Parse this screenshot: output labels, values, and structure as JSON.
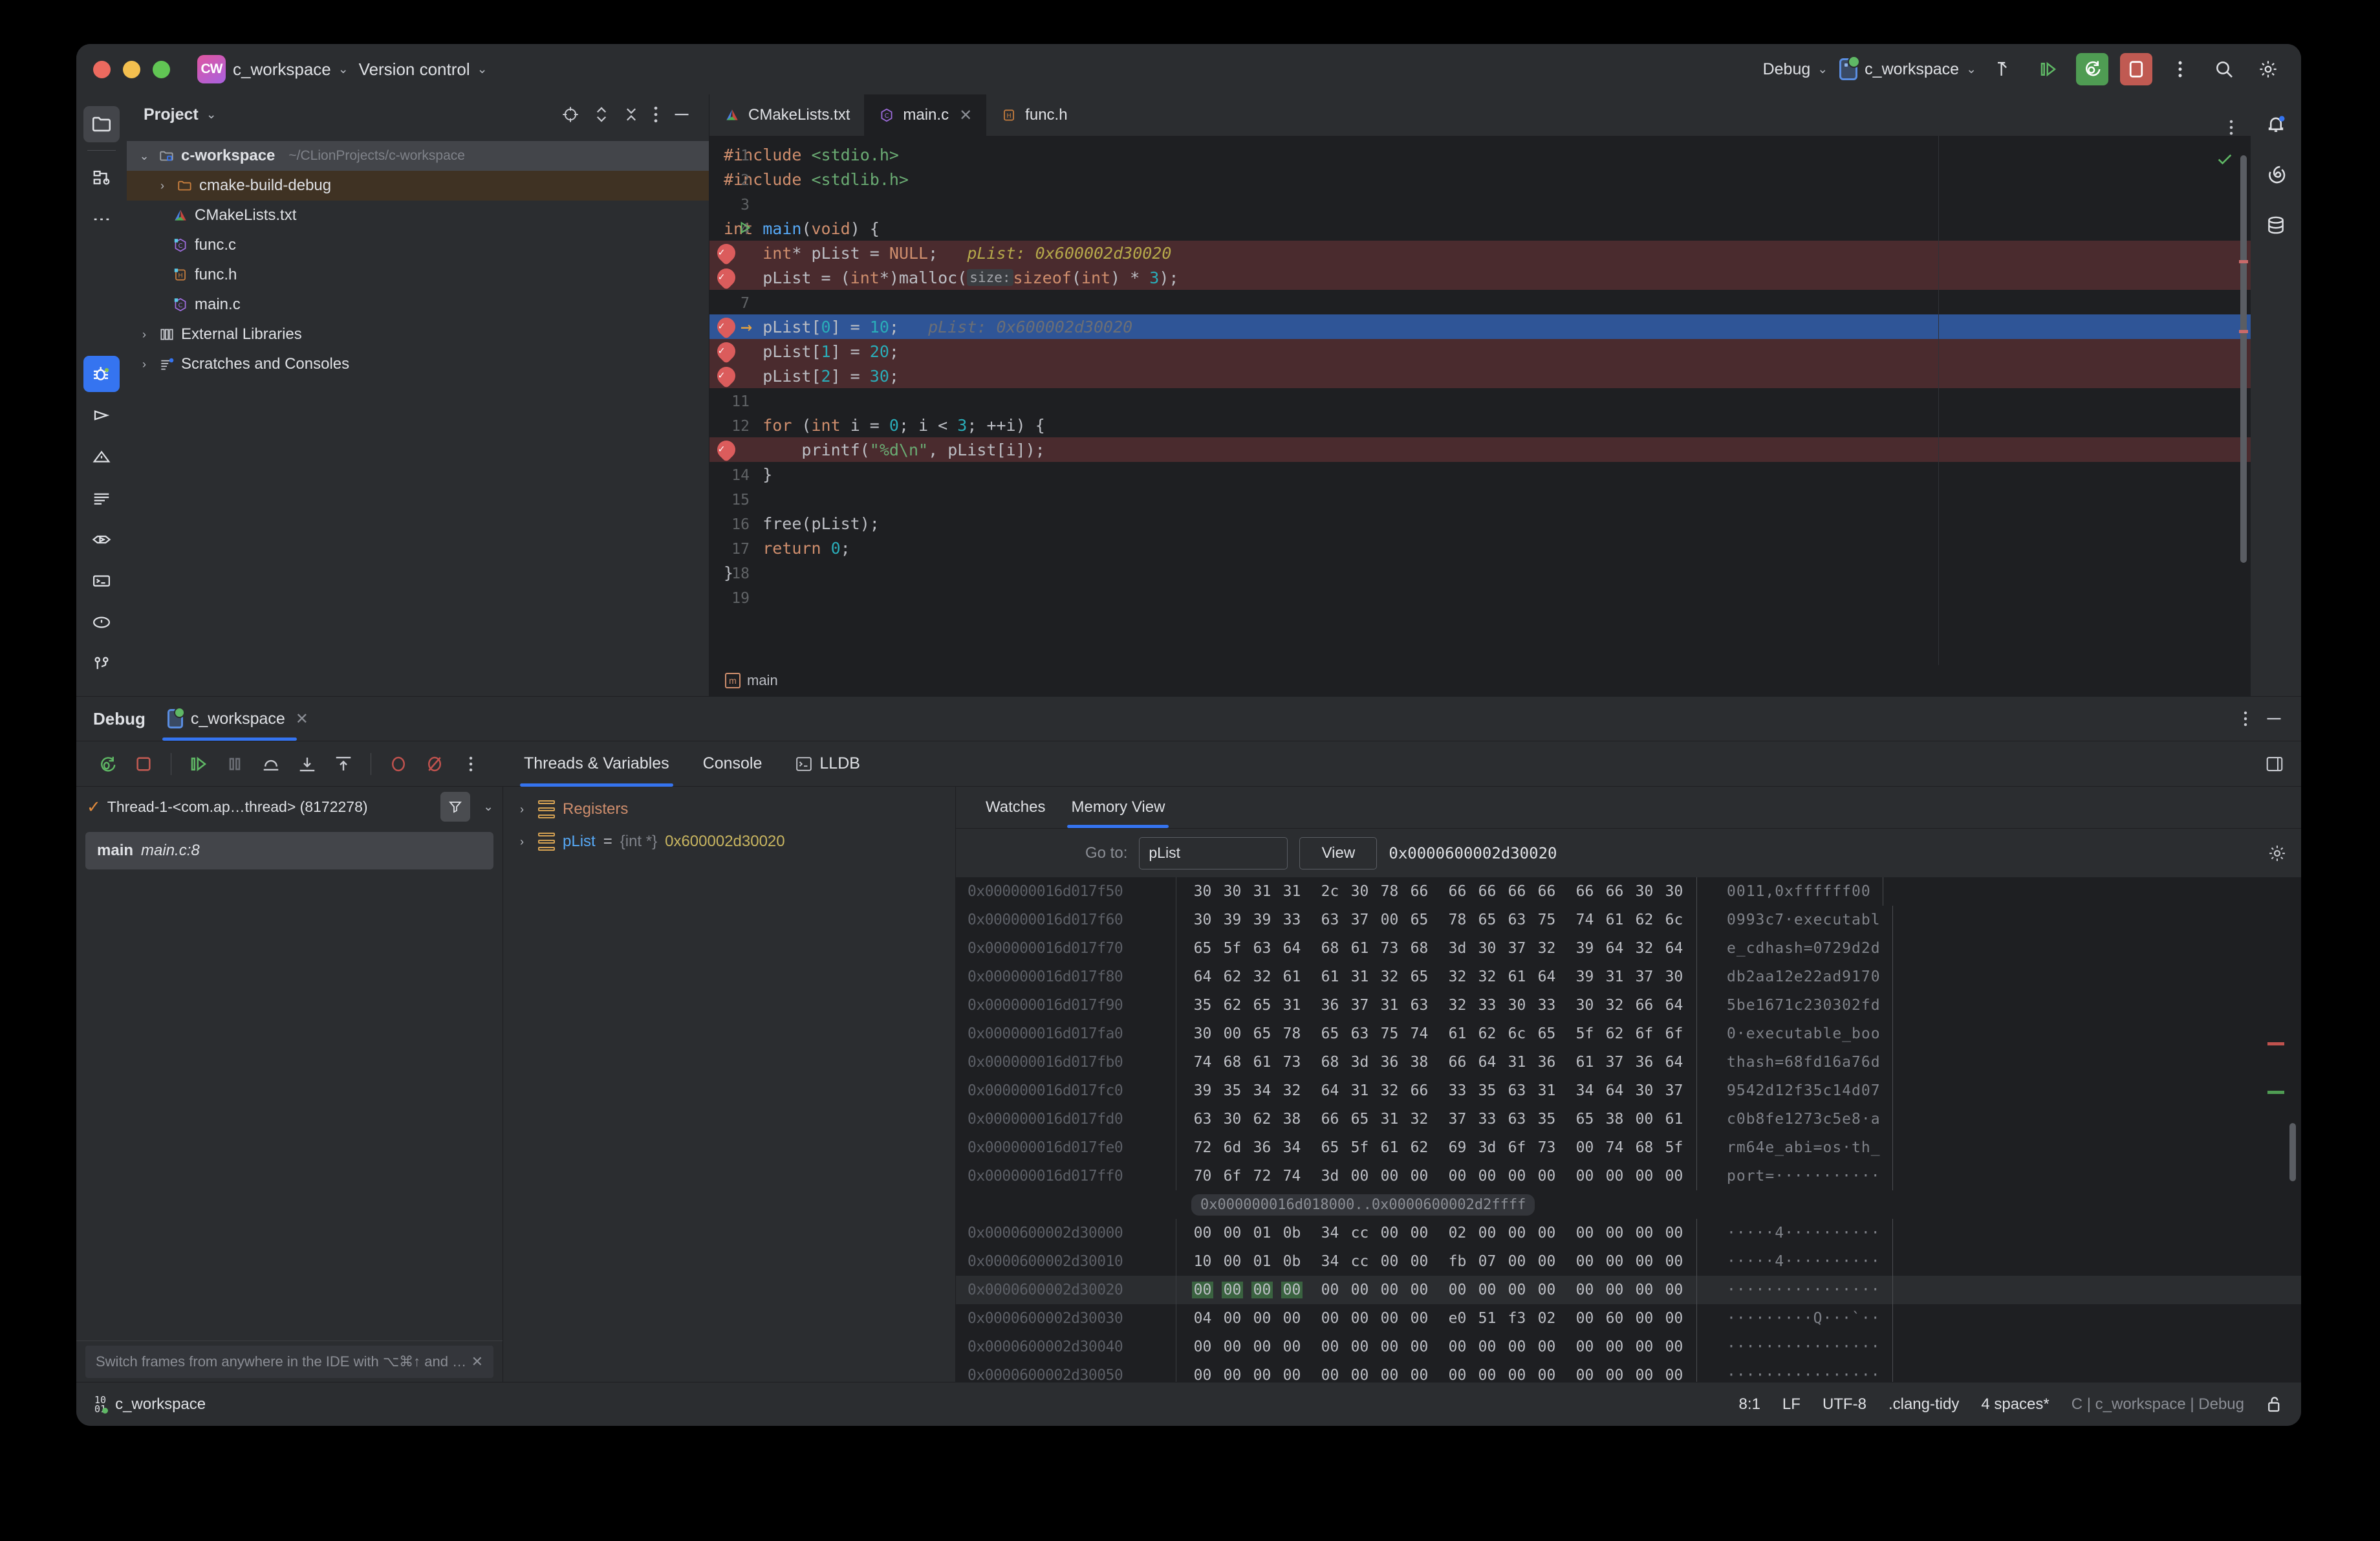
{
  "titlebar": {
    "project_badge": "CW",
    "project_name": "c_workspace",
    "version_control": "Version control",
    "run_config_mode": "Debug",
    "run_config_name": "c_workspace",
    "chevron": "⌄"
  },
  "project_panel": {
    "title": "Project",
    "chevron": "⌄",
    "tree": [
      {
        "label": "c-workspace",
        "detail": "~/CLionProjects/c-workspace",
        "icon": "folder-project-icon",
        "state": "selected",
        "depth": 0,
        "arrow": "⌄"
      },
      {
        "label": "cmake-build-debug",
        "detail": "",
        "icon": "folder-icon",
        "state": "highlighted",
        "depth": 1,
        "arrow": "›"
      },
      {
        "label": "CMakeLists.txt",
        "detail": "",
        "icon": "cmake-icon",
        "state": "",
        "depth": 1,
        "arrow": ""
      },
      {
        "label": "func.c",
        "detail": "",
        "icon": "c-file-icon",
        "state": "",
        "depth": 1,
        "arrow": ""
      },
      {
        "label": "func.h",
        "detail": "",
        "icon": "h-file-icon",
        "state": "",
        "depth": 1,
        "arrow": ""
      },
      {
        "label": "main.c",
        "detail": "",
        "icon": "c-file-icon",
        "state": "",
        "depth": 1,
        "arrow": ""
      },
      {
        "label": "External Libraries",
        "detail": "",
        "icon": "library-icon",
        "state": "",
        "depth": 0,
        "arrow": "›"
      },
      {
        "label": "Scratches and Consoles",
        "detail": "",
        "icon": "scratches-icon",
        "state": "",
        "depth": 0,
        "arrow": "›"
      }
    ]
  },
  "editor": {
    "tabs": [
      {
        "label": "CMakeLists.txt",
        "icon": "cmake-icon",
        "active": false,
        "closable": false
      },
      {
        "label": "main.c",
        "icon": "c-file-icon",
        "active": true,
        "closable": true
      },
      {
        "label": "func.h",
        "icon": "h-file-icon",
        "active": false,
        "closable": false
      }
    ],
    "close_glyph": "✕",
    "breadcrumb": "main",
    "breadcrumb_icon": "m",
    "lines": [
      {
        "num": "1",
        "breakpoint": false,
        "state": "",
        "segments": [
          {
            "t": "#include ",
            "c": "kw"
          },
          {
            "t": "<stdio.h>",
            "c": "inc"
          }
        ]
      },
      {
        "num": "2",
        "breakpoint": false,
        "state": "",
        "segments": [
          {
            "t": "#include ",
            "c": "kw"
          },
          {
            "t": "<stdlib.h>",
            "c": "inc"
          }
        ]
      },
      {
        "num": "3",
        "breakpoint": false,
        "state": "",
        "segments": []
      },
      {
        "num": "4",
        "breakpoint": false,
        "state": "",
        "gutter_run": true,
        "segments": [
          {
            "t": "int ",
            "c": "kw"
          },
          {
            "t": "main",
            "c": "fn"
          },
          {
            "t": "(",
            "c": ""
          },
          {
            "t": "void",
            "c": "kw"
          },
          {
            "t": ") {",
            "c": ""
          }
        ]
      },
      {
        "num": "5",
        "breakpoint": true,
        "state": "red",
        "segments": [
          {
            "t": "    ",
            "c": ""
          },
          {
            "t": "int",
            "c": "kw"
          },
          {
            "t": "* pList = ",
            "c": ""
          },
          {
            "t": "NULL",
            "c": "num2"
          },
          {
            "t": ";   ",
            "c": ""
          },
          {
            "t": "pList: 0x600002d30020",
            "c": "hint-yellow"
          }
        ]
      },
      {
        "num": "6",
        "breakpoint": true,
        "state": "red",
        "segments": [
          {
            "t": "    pList = (",
            "c": ""
          },
          {
            "t": "int",
            "c": "kw"
          },
          {
            "t": "*)malloc(",
            "c": ""
          },
          {
            "t": "size:",
            "c": "inlay"
          },
          {
            "t": "sizeof",
            "c": "kw"
          },
          {
            "t": "(",
            "c": ""
          },
          {
            "t": "int",
            "c": "kw"
          },
          {
            "t": ") * ",
            "c": ""
          },
          {
            "t": "3",
            "c": "num"
          },
          {
            "t": ");",
            "c": ""
          }
        ]
      },
      {
        "num": "7",
        "breakpoint": false,
        "state": "",
        "segments": []
      },
      {
        "num": "8",
        "breakpoint": true,
        "state": "blue",
        "exec": true,
        "segments": [
          {
            "t": "    pList[",
            "c": ""
          },
          {
            "t": "0",
            "c": "num"
          },
          {
            "t": "] = ",
            "c": ""
          },
          {
            "t": "10",
            "c": "num"
          },
          {
            "t": ";   ",
            "c": ""
          },
          {
            "t": "pList: 0x600002d30020",
            "c": "hint"
          }
        ]
      },
      {
        "num": "9",
        "breakpoint": true,
        "state": "red",
        "segments": [
          {
            "t": "    pList[",
            "c": ""
          },
          {
            "t": "1",
            "c": "num"
          },
          {
            "t": "] = ",
            "c": ""
          },
          {
            "t": "20",
            "c": "num"
          },
          {
            "t": ";",
            "c": ""
          }
        ]
      },
      {
        "num": "10",
        "breakpoint": true,
        "state": "red",
        "segments": [
          {
            "t": "    pList[",
            "c": ""
          },
          {
            "t": "2",
            "c": "num"
          },
          {
            "t": "] = ",
            "c": ""
          },
          {
            "t": "30",
            "c": "num"
          },
          {
            "t": ";",
            "c": ""
          }
        ]
      },
      {
        "num": "11",
        "breakpoint": false,
        "state": "",
        "segments": []
      },
      {
        "num": "12",
        "breakpoint": false,
        "state": "",
        "segments": [
          {
            "t": "    ",
            "c": ""
          },
          {
            "t": "for",
            "c": "kw"
          },
          {
            "t": " (",
            "c": ""
          },
          {
            "t": "int",
            "c": "kw"
          },
          {
            "t": " i = ",
            "c": ""
          },
          {
            "t": "0",
            "c": "num"
          },
          {
            "t": "; i < ",
            "c": ""
          },
          {
            "t": "3",
            "c": "num"
          },
          {
            "t": "; ++i) {",
            "c": ""
          }
        ]
      },
      {
        "num": "13",
        "breakpoint": true,
        "state": "red",
        "segments": [
          {
            "t": "        printf(",
            "c": ""
          },
          {
            "t": "\"%d\\n\"",
            "c": "str"
          },
          {
            "t": ", pList[i]);",
            "c": ""
          }
        ]
      },
      {
        "num": "14",
        "breakpoint": false,
        "state": "",
        "segments": [
          {
            "t": "    }",
            "c": ""
          }
        ]
      },
      {
        "num": "15",
        "breakpoint": false,
        "state": "",
        "segments": []
      },
      {
        "num": "16",
        "breakpoint": false,
        "state": "",
        "segments": [
          {
            "t": "    free(pList);",
            "c": ""
          }
        ]
      },
      {
        "num": "17",
        "breakpoint": false,
        "state": "",
        "segments": [
          {
            "t": "    ",
            "c": ""
          },
          {
            "t": "return",
            "c": "kw"
          },
          {
            "t": " ",
            "c": ""
          },
          {
            "t": "0",
            "c": "num"
          },
          {
            "t": ";",
            "c": ""
          }
        ]
      },
      {
        "num": "18",
        "breakpoint": false,
        "state": "",
        "segments": [
          {
            "t": "}",
            "c": ""
          }
        ]
      },
      {
        "num": "19",
        "breakpoint": false,
        "state": "",
        "segments": []
      }
    ]
  },
  "debug": {
    "title": "Debug",
    "session_tab": "c_workspace",
    "session_close": "✕",
    "tabs": [
      {
        "label": "Threads & Variables",
        "active": true,
        "icon": ""
      },
      {
        "label": "Console",
        "active": false,
        "icon": ""
      },
      {
        "label": "LLDB",
        "active": false,
        "icon": "terminal-icon"
      }
    ],
    "thread": "Thread-1-<com.ap…thread> (8172278)",
    "thread_check": "✓",
    "frame_name": "main",
    "frame_location": "main.c:8",
    "hint": "Switch frames from anywhere in the IDE with ⌥⌘↑ and …",
    "hint_close": "✕",
    "variables": [
      {
        "name": "Registers",
        "type": "",
        "value": "",
        "kind": "registers",
        "arrow": "›"
      },
      {
        "name": "pList",
        "type": "{int *}",
        "value": "0x600002d30020",
        "kind": "var",
        "arrow": "›"
      }
    ]
  },
  "memory": {
    "tabs": [
      {
        "label": "Watches",
        "active": false
      },
      {
        "label": "Memory View",
        "active": true
      }
    ],
    "goto_label": "Go to:",
    "goto_value": "pList",
    "view_button": "View",
    "address": "0x0000600002d30020",
    "gap_label": "0x000000016d018000..0x0000600002d2ffff",
    "rows": [
      {
        "addr": "0x000000016d017f50",
        "bytes": [
          "30",
          "30",
          "31",
          "31",
          "2c",
          "30",
          "78",
          "66",
          "66",
          "66",
          "66",
          "66",
          "66",
          "66",
          "30",
          "30"
        ],
        "ascii": "0011,0xffffff00",
        "cur": false,
        "sel": []
      },
      {
        "addr": "0x000000016d017f60",
        "bytes": [
          "30",
          "39",
          "39",
          "33",
          "63",
          "37",
          "00",
          "65",
          "78",
          "65",
          "63",
          "75",
          "74",
          "61",
          "62",
          "6c"
        ],
        "ascii": "0993c7·executabl",
        "cur": false,
        "sel": []
      },
      {
        "addr": "0x000000016d017f70",
        "bytes": [
          "65",
          "5f",
          "63",
          "64",
          "68",
          "61",
          "73",
          "68",
          "3d",
          "30",
          "37",
          "32",
          "39",
          "64",
          "32",
          "64"
        ],
        "ascii": "e_cdhash=0729d2d",
        "cur": false,
        "sel": []
      },
      {
        "addr": "0x000000016d017f80",
        "bytes": [
          "64",
          "62",
          "32",
          "61",
          "61",
          "31",
          "32",
          "65",
          "32",
          "32",
          "61",
          "64",
          "39",
          "31",
          "37",
          "30"
        ],
        "ascii": "db2aa12e22ad9170",
        "cur": false,
        "sel": []
      },
      {
        "addr": "0x000000016d017f90",
        "bytes": [
          "35",
          "62",
          "65",
          "31",
          "36",
          "37",
          "31",
          "63",
          "32",
          "33",
          "30",
          "33",
          "30",
          "32",
          "66",
          "64"
        ],
        "ascii": "5be1671c230302fd",
        "cur": false,
        "sel": []
      },
      {
        "addr": "0x000000016d017fa0",
        "bytes": [
          "30",
          "00",
          "65",
          "78",
          "65",
          "63",
          "75",
          "74",
          "61",
          "62",
          "6c",
          "65",
          "5f",
          "62",
          "6f",
          "6f"
        ],
        "ascii": "0·executable_boo",
        "cur": false,
        "sel": []
      },
      {
        "addr": "0x000000016d017fb0",
        "bytes": [
          "74",
          "68",
          "61",
          "73",
          "68",
          "3d",
          "36",
          "38",
          "66",
          "64",
          "31",
          "36",
          "61",
          "37",
          "36",
          "64"
        ],
        "ascii": "thash=68fd16a76d",
        "cur": false,
        "sel": []
      },
      {
        "addr": "0x000000016d017fc0",
        "bytes": [
          "39",
          "35",
          "34",
          "32",
          "64",
          "31",
          "32",
          "66",
          "33",
          "35",
          "63",
          "31",
          "34",
          "64",
          "30",
          "37"
        ],
        "ascii": "9542d12f35c14d07",
        "cur": false,
        "sel": []
      },
      {
        "addr": "0x000000016d017fd0",
        "bytes": [
          "63",
          "30",
          "62",
          "38",
          "66",
          "65",
          "31",
          "32",
          "37",
          "33",
          "63",
          "35",
          "65",
          "38",
          "00",
          "61"
        ],
        "ascii": "c0b8fe1273c5e8·a",
        "cur": false,
        "sel": []
      },
      {
        "addr": "0x000000016d017fe0",
        "bytes": [
          "72",
          "6d",
          "36",
          "34",
          "65",
          "5f",
          "61",
          "62",
          "69",
          "3d",
          "6f",
          "73",
          "00",
          "74",
          "68",
          "5f"
        ],
        "ascii": "rm64e_abi=os·th_",
        "cur": false,
        "sel": []
      },
      {
        "addr": "0x000000016d017ff0",
        "bytes": [
          "70",
          "6f",
          "72",
          "74",
          "3d",
          "00",
          "00",
          "00",
          "00",
          "00",
          "00",
          "00",
          "00",
          "00",
          "00",
          "00"
        ],
        "ascii": "port=···········",
        "cur": false,
        "sel": []
      },
      {
        "addr": "0x0000600002d30000",
        "bytes": [
          "00",
          "00",
          "01",
          "0b",
          "34",
          "cc",
          "00",
          "00",
          "02",
          "00",
          "00",
          "00",
          "00",
          "00",
          "00",
          "00"
        ],
        "ascii": "·····4··········",
        "cur": false,
        "sel": []
      },
      {
        "addr": "0x0000600002d30010",
        "bytes": [
          "10",
          "00",
          "01",
          "0b",
          "34",
          "cc",
          "00",
          "00",
          "fb",
          "07",
          "00",
          "00",
          "00",
          "00",
          "00",
          "00"
        ],
        "ascii": "·····4··········",
        "cur": false,
        "sel": []
      },
      {
        "addr": "0x0000600002d30020",
        "bytes": [
          "00",
          "00",
          "00",
          "00",
          "00",
          "00",
          "00",
          "00",
          "00",
          "00",
          "00",
          "00",
          "00",
          "00",
          "00",
          "00"
        ],
        "ascii": "················",
        "cur": true,
        "sel": [
          0,
          1,
          2,
          3
        ]
      },
      {
        "addr": "0x0000600002d30030",
        "bytes": [
          "04",
          "00",
          "00",
          "00",
          "00",
          "00",
          "00",
          "00",
          "e0",
          "51",
          "f3",
          "02",
          "00",
          "60",
          "00",
          "00"
        ],
        "ascii": "·········Q···`··",
        "cur": false,
        "sel": []
      },
      {
        "addr": "0x0000600002d30040",
        "bytes": [
          "00",
          "00",
          "00",
          "00",
          "00",
          "00",
          "00",
          "00",
          "00",
          "00",
          "00",
          "00",
          "00",
          "00",
          "00",
          "00"
        ],
        "ascii": "················",
        "cur": false,
        "sel": []
      },
      {
        "addr": "0x0000600002d30050",
        "bytes": [
          "00",
          "00",
          "00",
          "00",
          "00",
          "00",
          "00",
          "00",
          "00",
          "00",
          "00",
          "00",
          "00",
          "00",
          "00",
          "00"
        ],
        "ascii": "················",
        "cur": false,
        "sel": []
      }
    ]
  },
  "statusbar": {
    "project": "c_workspace",
    "caret": "8:1",
    "line_sep": "LF",
    "encoding": "UTF-8",
    "inspection": ".clang-tidy",
    "indent": "4 spaces*",
    "context": "C | c_workspace | Debug"
  }
}
